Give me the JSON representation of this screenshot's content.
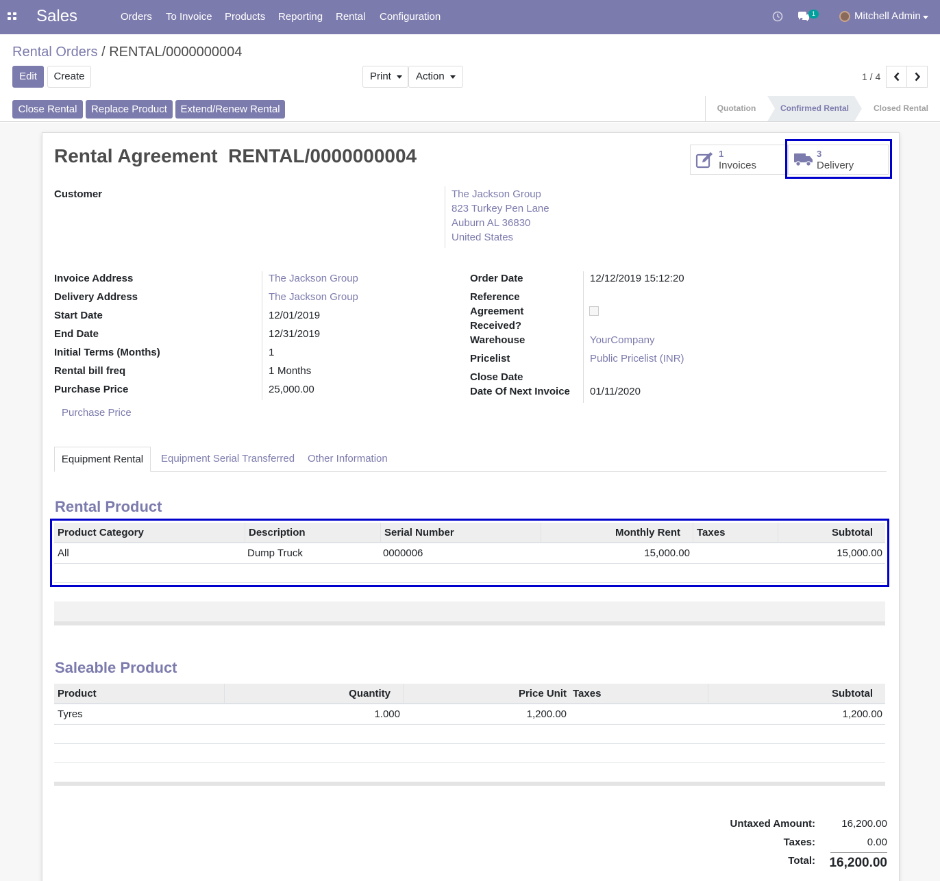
{
  "navbar": {
    "app_name": "Sales",
    "menu": [
      "Orders",
      "To Invoice",
      "Products",
      "Reporting",
      "Rental",
      "Configuration"
    ],
    "messages_badge": "1",
    "user_name": "Mitchell Admin",
    "icons": [
      "apps-icon",
      "clock-icon",
      "chat-icon",
      "avatar",
      "caret-down-icon"
    ]
  },
  "breadcrumb": {
    "parent": "Rental Orders",
    "separator": "/",
    "current": "RENTAL/0000000004"
  },
  "buttons": {
    "edit": "Edit",
    "create": "Create",
    "print": "Print",
    "action": "Action"
  },
  "pager": {
    "text": "1 / 4",
    "prev_icon": "chevron-left-icon",
    "next_icon": "chevron-right-icon"
  },
  "header_buttons": [
    "Close Rental",
    "Replace Product",
    "Extend/Renew Rental"
  ],
  "statusbar": {
    "stages": [
      "Quotation",
      "Confirmed Rental",
      "Closed Rental"
    ],
    "active": "Confirmed Rental"
  },
  "form": {
    "title_prefix": "Rental Agreement",
    "title_name": "RENTAL/0000000004",
    "smart_buttons": {
      "invoices": {
        "count": "1",
        "label": "Invoices",
        "icon": "edit-icon"
      },
      "delivery": {
        "count": "3",
        "label": "Delivery",
        "icon": "truck-icon"
      }
    },
    "customer_label": "Customer",
    "customer_address": [
      "The Jackson Group",
      "823 Turkey Pen Lane",
      "Auburn AL 36830",
      "United States"
    ],
    "left_fields": {
      "invoice_address": {
        "label": "Invoice Address",
        "value": "The Jackson Group"
      },
      "delivery_address": {
        "label": "Delivery Address",
        "value": "The Jackson Group"
      },
      "start_date": {
        "label": "Start Date",
        "value": "12/01/2019"
      },
      "end_date": {
        "label": "End Date",
        "value": "12/31/2019"
      },
      "initial_terms": {
        "label": "Initial Terms (Months)",
        "value": "1"
      },
      "bill_freq": {
        "label": "Rental bill freq",
        "value": "1",
        "unit": "Months"
      },
      "purchase_price": {
        "label": "Purchase Price",
        "value": "25,000.00"
      }
    },
    "purchase_price_link": "Purchase Price",
    "right_fields": {
      "order_date": {
        "label": "Order Date",
        "value": "12/12/2019 15:12:20"
      },
      "reference": {
        "label": "Reference",
        "value": ""
      },
      "agreement_received": {
        "label_1": "Agreement",
        "label_2": "Received?",
        "checked": false
      },
      "warehouse": {
        "label": "Warehouse",
        "value": "YourCompany"
      },
      "pricelist": {
        "label": "Pricelist",
        "value": "Public Pricelist (INR)"
      },
      "close_date": {
        "label": "Close Date",
        "value": ""
      },
      "next_invoice": {
        "label": "Date Of Next Invoice",
        "value": "01/11/2020"
      }
    },
    "tabs": [
      "Equipment Rental",
      "Equipment Serial Transferred",
      "Other Information"
    ],
    "active_tab": "Equipment Rental"
  },
  "rental_product": {
    "title": "Rental Product",
    "columns": [
      "Product Category",
      "Description",
      "Serial Number",
      "Monthly Rent",
      "Taxes",
      "Subtotal"
    ],
    "rows": [
      {
        "category": "All",
        "description": "Dump Truck",
        "serial": "0000006",
        "monthly_rent": "15,000.00",
        "taxes": "",
        "subtotal": "15,000.00"
      }
    ]
  },
  "saleable_product": {
    "title": "Saleable Product",
    "columns": [
      "Product",
      "Quantity",
      "Price Unit",
      "Taxes",
      "Subtotal"
    ],
    "rows": [
      {
        "product": "Tyres",
        "quantity": "1.000",
        "price_unit": "1,200.00",
        "taxes": "",
        "subtotal": "1,200.00"
      }
    ]
  },
  "totals": {
    "untaxed_label": "Untaxed Amount:",
    "untaxed": "16,200.00",
    "taxes_label": "Taxes:",
    "taxes": "0.00",
    "total_label": "Total:",
    "total": "16,200.00"
  },
  "colors": {
    "brand": "#7c7bad",
    "highlight": "#0000cc",
    "badge": "#00a09d"
  }
}
